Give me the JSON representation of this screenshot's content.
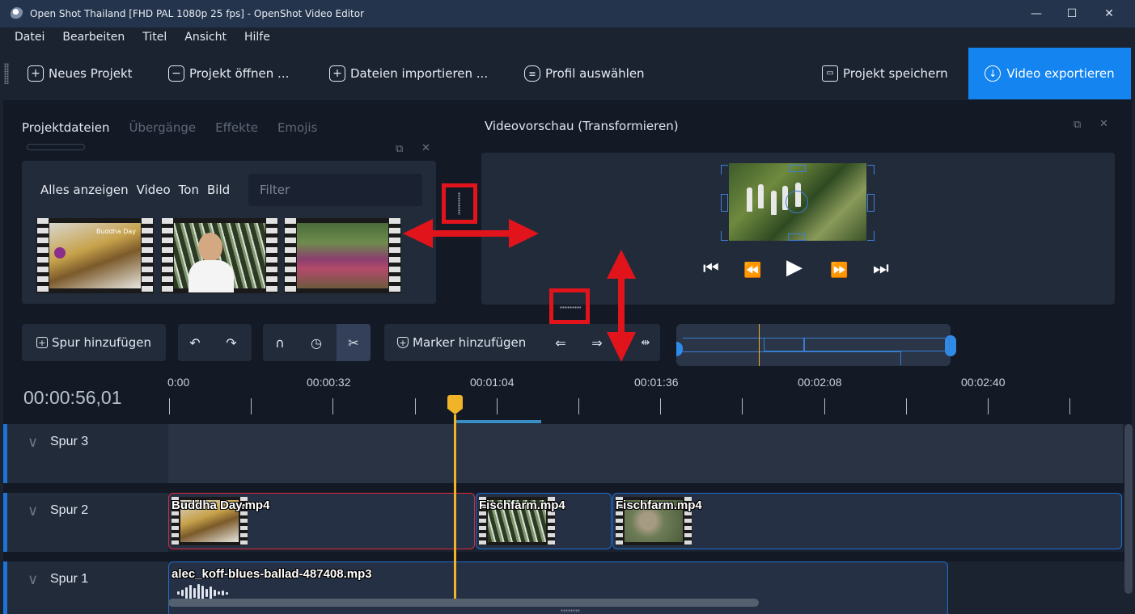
{
  "window": {
    "title": "Open Shot Thailand [FHD PAL 1080p 25 fps] - OpenShot Video Editor",
    "minimize": "—",
    "maximize": "☐",
    "close": "✕"
  },
  "menu": [
    "Datei",
    "Bearbeiten",
    "Titel",
    "Ansicht",
    "Hilfe"
  ],
  "toolbar": {
    "new_project": "Neues Projekt",
    "open_project": "Projekt öffnen ...",
    "import_files": "Dateien importieren ...",
    "choose_profile": "Profil auswählen",
    "save_project": "Projekt speichern",
    "export_video": "Video exportieren"
  },
  "project_files": {
    "tabs": [
      "Projektdateien",
      "Übergänge",
      "Effekte",
      "Emojis"
    ],
    "active_tab": "Projektdateien",
    "filters": [
      "Alles anzeigen",
      "Video",
      "Ton",
      "Bild"
    ],
    "filter_placeholder": "Filter",
    "thumb_caption": "Buddha Day"
  },
  "preview": {
    "title": "Videovorschau (Transformieren)"
  },
  "timeline_toolbar": {
    "add_track": "Spur hinzufügen",
    "add_marker": "Marker hinzufügen"
  },
  "timeline": {
    "timecode": "00:00:56,01",
    "ruler_labels": [
      "0:00",
      "00:00:32",
      "00:01:04",
      "00:01:36",
      "00:02:08",
      "00:02:40"
    ],
    "tracks": [
      {
        "name": "Spur 3",
        "clips": []
      },
      {
        "name": "Spur 2",
        "clips": [
          "Buddha Day.mp4",
          "Fischfarm.mp4",
          "Fischfarm.mp4"
        ]
      },
      {
        "name": "Spur 1",
        "clips": [
          "alec_koff-blues-ballad-487408.mp3"
        ]
      }
    ]
  },
  "colors": {
    "accent": "#1384f0",
    "playhead": "#f0b429",
    "selected_clip": "#e0283a",
    "annotation": "#e1141c"
  }
}
